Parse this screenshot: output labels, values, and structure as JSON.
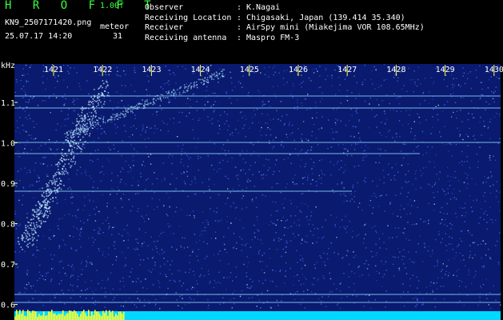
{
  "app": {
    "title": "H R O F F T",
    "version": "1.00f"
  },
  "file": {
    "name": "KN9_2507171420.png",
    "datetime": "25.07.17 14:20"
  },
  "meteor": {
    "label": "meteor",
    "count": "31"
  },
  "info": [
    {
      "label": "Observer",
      "value": "K.Nagai"
    },
    {
      "label": "Receiving Location",
      "value": "Chigasaki, Japan (139.414 35.340)"
    },
    {
      "label": "Receiver",
      "value": "AirSpy mini (Miakejima VOR 108.65MHz)"
    },
    {
      "label": "Receiving antenna",
      "value": "Maspro FM-3"
    }
  ],
  "spectrogram": {
    "y_unit": "kHz",
    "y_ticks": [
      "1.1",
      "1.0",
      "0.9",
      "0.8",
      "0.7",
      "0.6"
    ],
    "x_ticks": [
      "1421",
      "1422",
      "1423",
      "1424",
      "1425",
      "1426",
      "1427",
      "1428",
      "1429",
      "1430"
    ],
    "colors": {
      "background": "#0a1a6e",
      "noise": "#3a6cff",
      "line": "#8fd8ff",
      "tick": "#ffff40"
    }
  }
}
